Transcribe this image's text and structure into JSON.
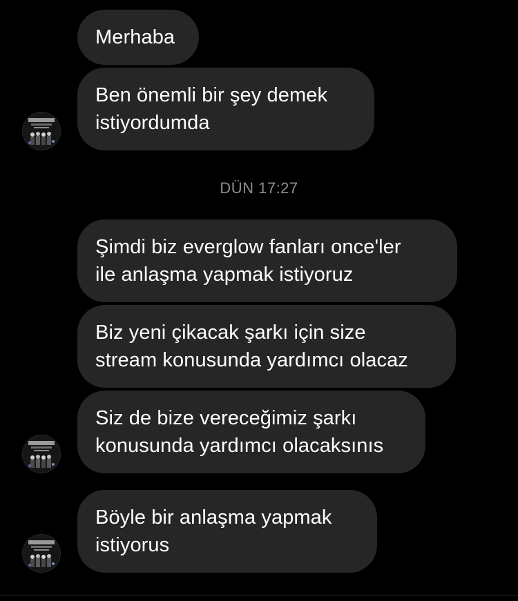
{
  "messages_group1": [
    {
      "text": "Merhaba"
    },
    {
      "text": "Ben önemli bir şey demek\nistiyordumda"
    }
  ],
  "timestamp": "DÜN 17:27",
  "messages_group2": [
    {
      "text": "Şimdi biz everglow fanları once'ler\nile anlaşma yapmak istiyoruz"
    },
    {
      "text": "Biz yeni çikacak şarkı için size\nstream konusunda yardımcı olacaz"
    },
    {
      "text": "Siz de bize vereceğimiz şarkı\nkonusunda yardımcı olacaksınıs"
    }
  ],
  "messages_group3": [
    {
      "text": "Böyle bir anlaşma yapmak\nistiyorus"
    }
  ],
  "colors": {
    "background": "#000000",
    "bubble": "#262626",
    "text": "#ffffff",
    "timestamp": "#8e8e8e"
  },
  "icons": {
    "avatar": "contact-avatar-icon"
  }
}
